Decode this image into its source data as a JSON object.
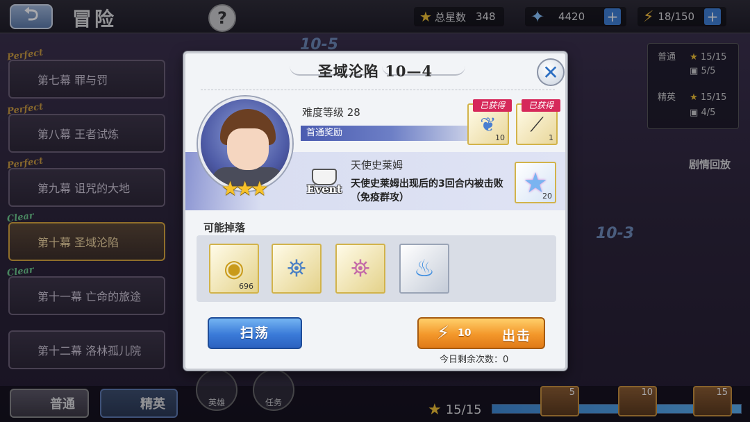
{
  "topbar": {
    "back_icon": "back-arrow-icon",
    "title": "冒险",
    "help_label": "?",
    "total_stars_label": "总星数",
    "total_stars_value": "348",
    "gems_value": "4420",
    "stamina_value": "18/150",
    "plus_label": "+"
  },
  "chapters": [
    {
      "tag": "Perfect",
      "label": "第七幕  罪与罚"
    },
    {
      "tag": "Perfect",
      "label": "第八幕  王者试炼"
    },
    {
      "tag": "Perfect",
      "label": "第九幕  诅咒的大地"
    },
    {
      "tag": "Clear",
      "label": "第十幕  圣域沦陷"
    },
    {
      "tag": "Clear",
      "label": "第十一幕  亡命的旅途"
    },
    {
      "tag": "",
      "label": "第十二幕  洛林孤儿院"
    }
  ],
  "mode_panel": {
    "normal_label": "普通",
    "normal_stars": "15/15",
    "normal_chests": "5/5",
    "elite_label": "精英",
    "elite_stars": "15/15",
    "elite_chests": "4/5"
  },
  "background": {
    "stage_top": "10-5",
    "stage_right": "10-3",
    "replay_label": "剧情回放",
    "perfect_label": "Perfect"
  },
  "bottom": {
    "tab_normal": "普通",
    "tab_elite": "精英",
    "nav_hero": "英雄",
    "nav_task": "任务",
    "progress_text": "15/15",
    "progress_fraction": 1.0,
    "chest_counts": [
      "5",
      "10",
      "15"
    ]
  },
  "modal": {
    "title": "圣域沦陷  10—4",
    "close_icon": "close-x-icon",
    "difficulty": "难度等级 28",
    "first_clear_label": "首通奖励",
    "hero_stars": "★★★",
    "rewards": [
      {
        "icon": "exp-wing-icon",
        "obtained": "已获得",
        "count": "10"
      },
      {
        "icon": "staff-weapon-icon",
        "obtained": "已获得",
        "count": "1"
      }
    ],
    "event": {
      "badge": "Event",
      "title": "天使史莱姆",
      "desc": "天使史莱姆出现后的3回合内被击败（免疫群攻）",
      "reward_icon": "star-crystal-icon",
      "reward_count": "20"
    },
    "drops_label": "可能掉落",
    "drops": [
      {
        "icon": "gold-coin-icon",
        "count": "696"
      },
      {
        "icon": "lantern-blue-icon",
        "count": ""
      },
      {
        "icon": "lantern-pink-icon",
        "count": ""
      },
      {
        "icon": "blue-flame-brazier-icon",
        "count": ""
      }
    ],
    "sweep_label": "扫荡",
    "battle_cost": "10",
    "battle_label": "出击",
    "remaining": "今日剩余次数：0"
  },
  "colors": {
    "accent_blue": "#3a7ad8",
    "accent_orange": "#f3972a",
    "obtained_red": "#d6285a",
    "star_gold": "#f7c22a"
  }
}
